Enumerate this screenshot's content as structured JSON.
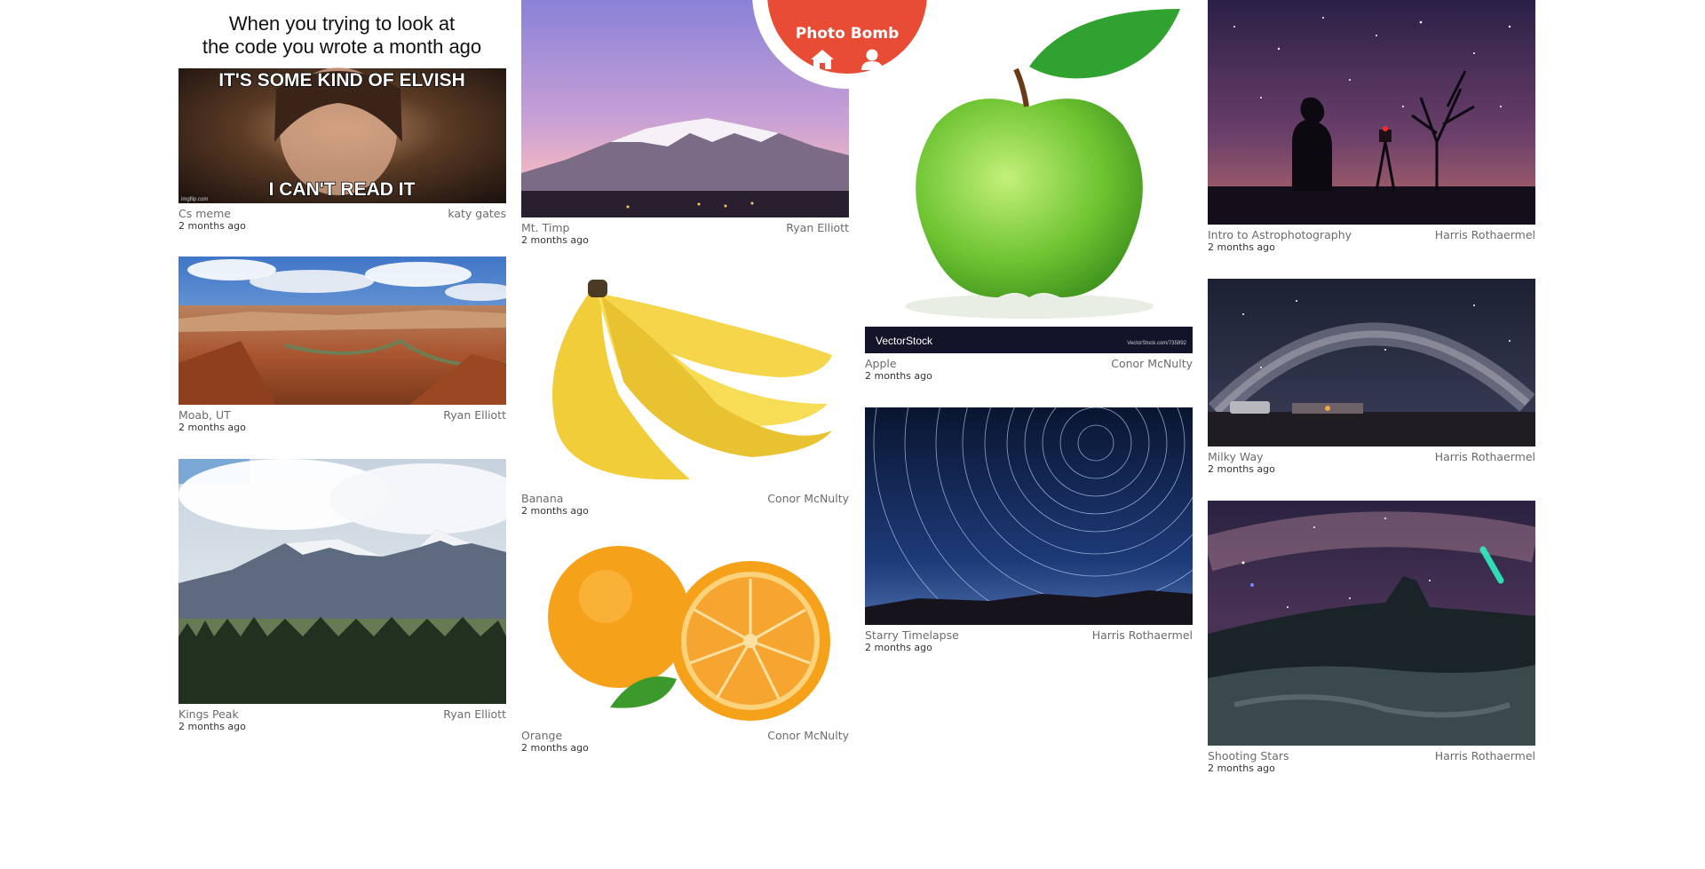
{
  "app": {
    "brand": "Photo Bomb"
  },
  "nav": {
    "home_icon": "home-icon",
    "user_icon": "user-icon"
  },
  "meme": {
    "top_line_1": "When you trying to look at",
    "top_line_2": "the code you wrote a month ago",
    "caption_top": "IT'S SOME KIND OF ELVISH",
    "caption_bottom": "I CAN'T READ IT",
    "credit": "imgflip.com"
  },
  "apple_watermark": {
    "brand": "VectorStock",
    "ref": "VectorStock.com/735892"
  },
  "columns": [
    [
      {
        "title": "Cs meme",
        "author": "katy gates",
        "time": "2 months ago"
      },
      {
        "title": "Moab, UT",
        "author": "Ryan Elliott",
        "time": "2 months ago"
      },
      {
        "title": "Kings Peak",
        "author": "Ryan Elliott",
        "time": "2 months ago"
      }
    ],
    [
      {
        "title": "Mt. Timp",
        "author": "Ryan Elliott",
        "time": "2 months ago"
      },
      {
        "title": "Banana",
        "author": "Conor McNulty",
        "time": "2 months ago"
      },
      {
        "title": "Orange",
        "author": "Conor McNulty",
        "time": "2 months ago"
      }
    ],
    [
      {
        "title": "Apple",
        "author": "Conor McNulty",
        "time": "2 months ago"
      },
      {
        "title": "Starry Timelapse",
        "author": "Harris Rothaermel",
        "time": "2 months ago"
      }
    ],
    [
      {
        "title": "Intro to Astrophotography",
        "author": "Harris Rothaermel",
        "time": "2 months ago"
      },
      {
        "title": "Milky Way",
        "author": "Harris Rothaermel",
        "time": "2 months ago"
      },
      {
        "title": "Shooting Stars",
        "author": "Harris Rothaermel",
        "time": "2 months ago"
      }
    ]
  ],
  "colors": {
    "accent": "#e94c35",
    "meta_text": "#6b6b6b",
    "background": "#ffffff"
  }
}
